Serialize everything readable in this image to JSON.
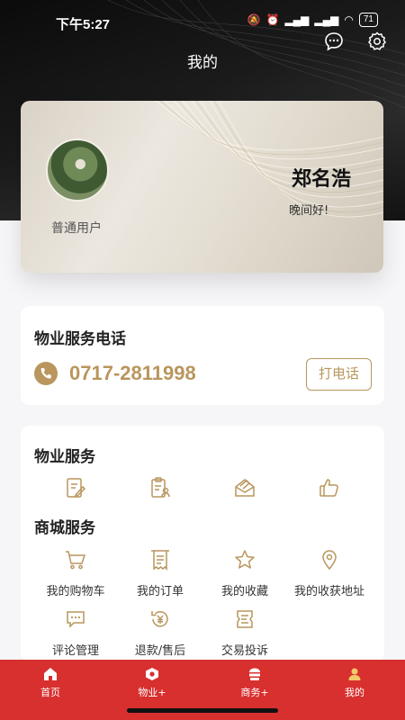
{
  "status_bar": {
    "time": "下午5:27",
    "battery": "71"
  },
  "header": {
    "title": "我的",
    "message_icon": "chat-bubble-icon",
    "settings_icon": "gear-icon"
  },
  "profile": {
    "role": "普通用户",
    "name": "郑名浩",
    "greeting": "晚间好!"
  },
  "phone_section": {
    "title": "物业服务电话",
    "number": "0717-2811998",
    "call_label": "打电话"
  },
  "property_service": {
    "title": "物业服务",
    "icons": [
      "edit-form-icon",
      "clipboard-person-icon",
      "envelope-icon",
      "thumbs-up-icon"
    ]
  },
  "mall_service": {
    "title": "商城服务",
    "items": [
      {
        "label": "我的购物车",
        "icon": "cart-icon"
      },
      {
        "label": "我的订单",
        "icon": "receipt-icon"
      },
      {
        "label": "我的收藏",
        "icon": "star-icon"
      },
      {
        "label": "我的收获地址",
        "icon": "location-pin-icon"
      },
      {
        "label": "评论管理",
        "icon": "comment-icon"
      },
      {
        "label": "退款/售后",
        "icon": "refund-icon"
      },
      {
        "label": "交易投诉",
        "icon": "complaint-icon"
      }
    ]
  },
  "tabbar": {
    "items": [
      {
        "label": "首页",
        "icon": "home-icon",
        "active": false
      },
      {
        "label": "物业+",
        "icon": "property-icon",
        "active": false
      },
      {
        "label": "商务+",
        "icon": "business-icon",
        "active": false
      },
      {
        "label": "我的",
        "icon": "person-icon",
        "active": true
      }
    ]
  },
  "colors": {
    "accent_gold": "#b9965d",
    "tabbar_red": "#d82f2f"
  }
}
